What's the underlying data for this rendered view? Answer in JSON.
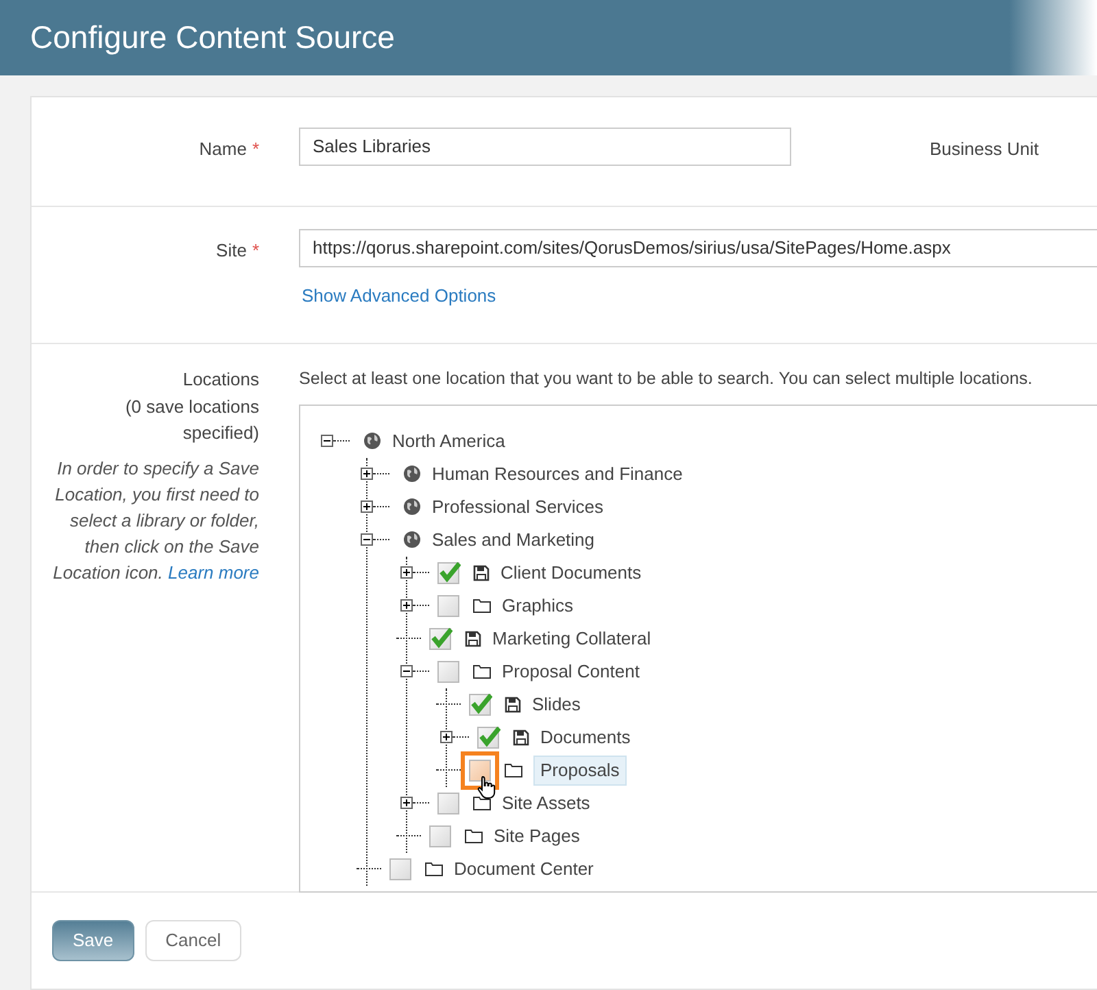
{
  "header": {
    "title": "Configure Content Source"
  },
  "name_field": {
    "label": "Name",
    "required_mark": "*",
    "value": "Sales Libraries"
  },
  "business_unit": {
    "label": "Business Unit"
  },
  "site_field": {
    "label": "Site",
    "required_mark": "*",
    "value": "https://qorus.sharepoint.com/sites/QorusDemos/sirius/usa/SitePages/Home.aspx",
    "advanced_link": "Show Advanced Options"
  },
  "locations": {
    "label": "Locations",
    "count": "(0 save locations specified)",
    "help": "In order to specify a Save Location, you first need to select a library or folder, then click on the Save Location icon.",
    "help_link": "Learn more",
    "instructions": "Select at least one location that you want to be able to search. You can select multiple locations.",
    "tree": [
      {
        "label": "North America",
        "kind": "globe",
        "expanded": true,
        "children": [
          {
            "label": "Human Resources and Finance",
            "kind": "globe",
            "expanded": false
          },
          {
            "label": "Professional Services",
            "kind": "globe",
            "expanded": false
          },
          {
            "label": "Sales and Marketing",
            "kind": "globe",
            "expanded": true,
            "children": [
              {
                "label": "Client Documents",
                "kind": "library",
                "checked": true,
                "selected": false,
                "expanded": false
              },
              {
                "label": "Graphics",
                "kind": "folder",
                "checked": false,
                "selected": false,
                "expanded": false
              },
              {
                "label": "Marketing Collateral",
                "kind": "library",
                "checked": true,
                "selected": false
              },
              {
                "label": "Proposal Content",
                "kind": "folder",
                "checked": false,
                "selected": false,
                "expanded": true,
                "children": [
                  {
                    "label": "Slides",
                    "kind": "library",
                    "checked": true,
                    "selected": false
                  },
                  {
                    "label": "Documents",
                    "kind": "library",
                    "checked": true,
                    "selected": false,
                    "expanded": false
                  },
                  {
                    "label": "Proposals",
                    "kind": "folder",
                    "checked": false,
                    "selected": true,
                    "highlighted": true
                  }
                ]
              },
              {
                "label": "Site Assets",
                "kind": "folder",
                "checked": false,
                "selected": false,
                "expanded": false
              },
              {
                "label": "Site Pages",
                "kind": "folder",
                "checked": false,
                "selected": false
              }
            ]
          },
          {
            "label": "Document Center",
            "kind": "folder",
            "checked": false,
            "selected": false
          }
        ]
      }
    ]
  },
  "buttons": [
    {
      "label": "Save",
      "kind": "primary"
    },
    {
      "label": "Cancel",
      "kind": "secondary"
    }
  ]
}
